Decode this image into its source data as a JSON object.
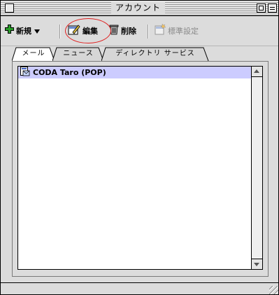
{
  "window": {
    "title": "アカウント"
  },
  "toolbar": {
    "new_label": "新規",
    "edit_label": "編集",
    "delete_label": "削除",
    "default_label": "標準設定"
  },
  "tabs": [
    {
      "label": "メール",
      "selected": true
    },
    {
      "label": "ニュース",
      "selected": false
    },
    {
      "label": "ディレクトリ サービス",
      "selected": false
    }
  ],
  "accounts": [
    {
      "name": "CODA Taro (POP)",
      "selected": true,
      "icon": "mail-account-icon"
    }
  ],
  "colors": {
    "selection": "#ccccff",
    "highlight_oval": "#e02020",
    "new_icon": "#2a9d2a"
  },
  "icons": {
    "new": "plus-icon",
    "edit": "edit-icon",
    "delete": "trash-icon",
    "default": "default-settings-icon"
  }
}
